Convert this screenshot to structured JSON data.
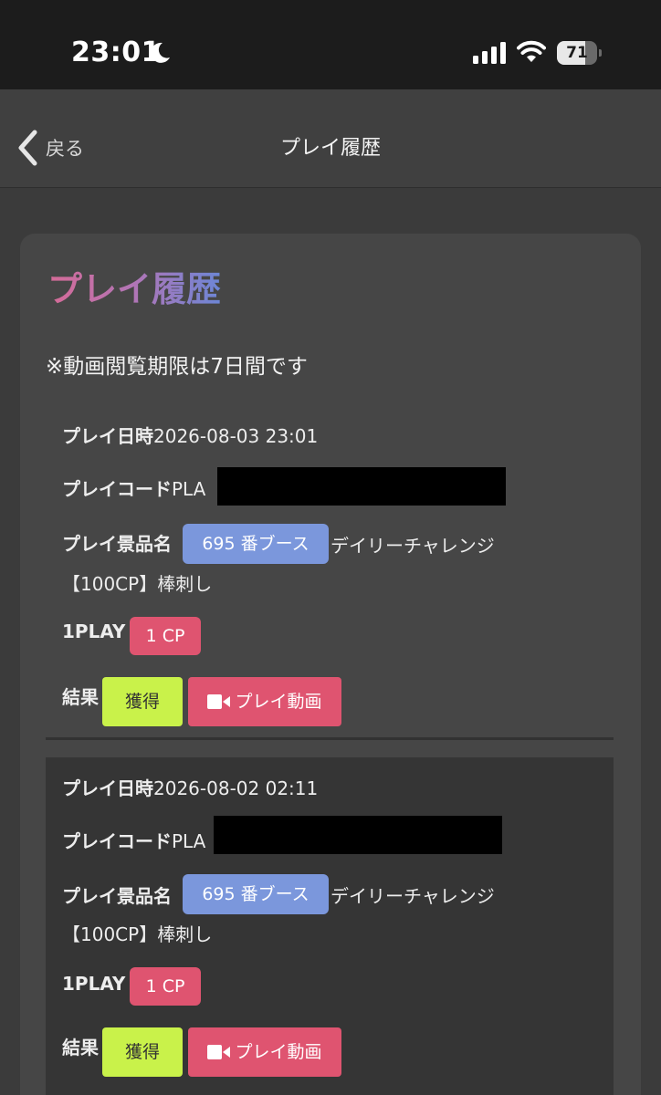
{
  "status_bar": {
    "time": "23:01",
    "battery_percent": "71",
    "battery_level": 0.71
  },
  "nav": {
    "back_label": "戻る",
    "title": "プレイ履歴"
  },
  "content": {
    "heading": "プレイ履歴",
    "heading_gradient": [
      "#d66b97",
      "#6c86d6"
    ],
    "notice": "※動画閲覧期限は7日間です",
    "records": [
      {
        "datetime_label": "プレイ日時",
        "datetime_value": "2026-08-03 23:01",
        "code_label": "プレイコード",
        "code_value": "PLA",
        "prize_label": "プレイ景品名",
        "booth": "695 番ブース",
        "prize_name_1": "デイリーチャレンジ",
        "prize_name_2": "【100CP】棒刺し",
        "cost_label": "1PLAY",
        "cost_value": "1 CP",
        "result_label": "結果",
        "result_value": "獲得",
        "video_button": "プレイ動画"
      },
      {
        "datetime_label": "プレイ日時",
        "datetime_value": "2026-08-02 02:11",
        "code_label": "プレイコード",
        "code_value": "PLA",
        "prize_label": "プレイ景品名",
        "booth": "695 番ブース",
        "prize_name_1": "デイリーチャレンジ",
        "prize_name_2": "【100CP】棒刺し",
        "cost_label": "1PLAY",
        "cost_value": "1 CP",
        "result_label": "結果",
        "result_value": "獲得",
        "video_button": "プレイ動画"
      }
    ]
  },
  "colors": {
    "booth_badge": "#7b97dc",
    "cp_badge": "#df5470",
    "result_badge": "#c9f24a",
    "video_button": "#df5470"
  },
  "icons": [
    "moon-icon",
    "signal-icon",
    "wifi-icon",
    "battery-icon",
    "chevron-left-icon",
    "video-camera-icon"
  ]
}
